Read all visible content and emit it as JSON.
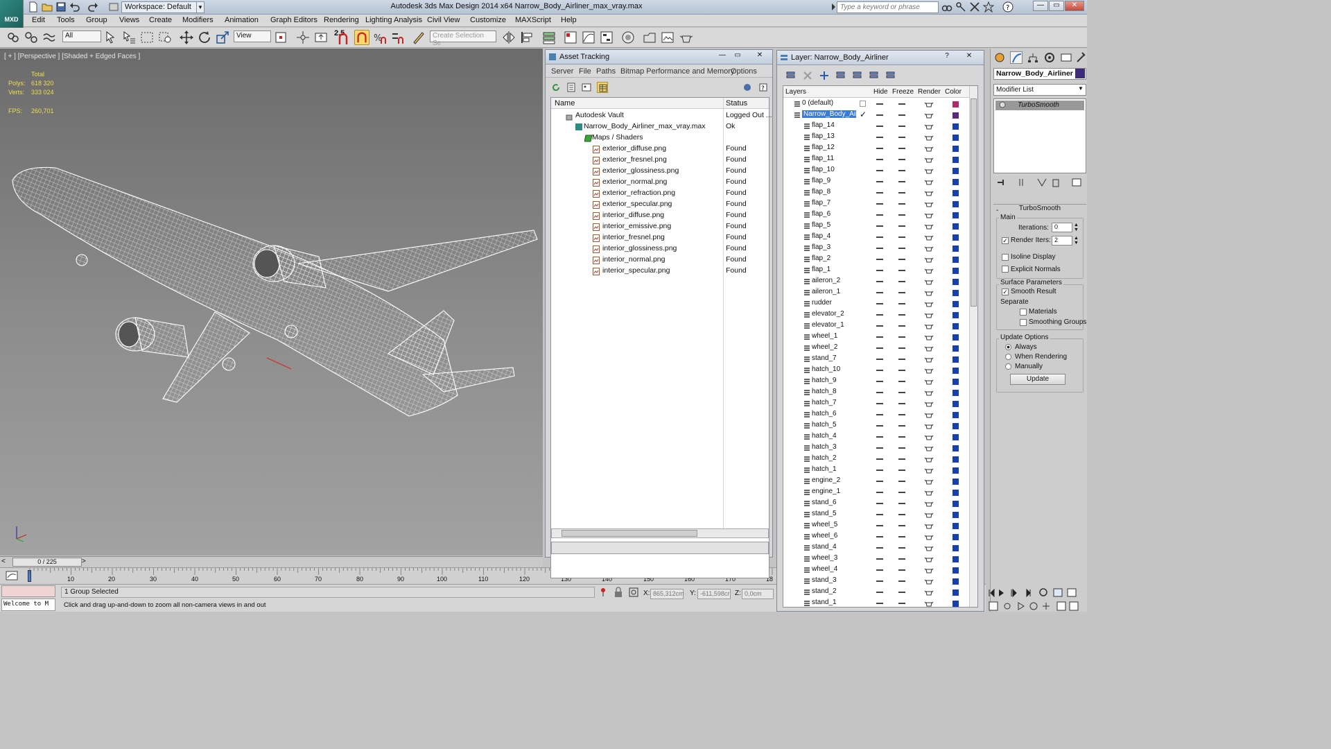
{
  "app": {
    "logo": "MXD",
    "title": "Autodesk 3ds Max Design 2014 x64     Narrow_Body_Airliner_max_vray.max",
    "workspace": "Workspace: Default",
    "search_placeholder": "Type a keyword or phrase"
  },
  "menus": [
    "Edit",
    "Tools",
    "Group",
    "Views",
    "Create",
    "Modifiers",
    "Animation",
    "Graph Editors",
    "Rendering",
    "Lighting Analysis",
    "Civil View",
    "Customize",
    "MAXScript",
    "Help"
  ],
  "toolbar": {
    "filter": "All",
    "ref_coord": "View",
    "snap_value": "2.5",
    "selection_set_placeholder": "Create Selection Se"
  },
  "viewport": {
    "label": "[ + ] [Perspective ] [Shaded + Edged Faces ]",
    "stats": {
      "total_label": "Total",
      "polys_label": "Polys:",
      "polys": "618 320",
      "verts_label": "Verts:",
      "verts": "333 024",
      "fps_label": "FPS:",
      "fps": "260,701"
    }
  },
  "time": {
    "slider": "0 / 225",
    "ticks": [
      "10",
      "20",
      "30",
      "40",
      "50",
      "60",
      "70",
      "80",
      "90",
      "100",
      "110",
      "120",
      "130",
      "140",
      "150",
      "160",
      "170",
      "18"
    ]
  },
  "status": {
    "listener": "Welcome to M",
    "selected": "1 Group Selected",
    "prompt": "Click and drag up-and-down to zoom all non-camera views in and out",
    "x_label": "X:",
    "x": "865,312cm",
    "y_label": "Y:",
    "y": "-611,598cr",
    "z_label": "Z:",
    "z": "0,0cm"
  },
  "asset_tracking": {
    "title": "Asset Tracking",
    "menus": [
      "Server",
      "File",
      "Paths",
      "Bitmap Performance and Memory",
      "Options"
    ],
    "col_name": "Name",
    "col_status": "Status",
    "vault": "Autodesk Vault",
    "vault_status": "Logged Out ...",
    "file": "Narrow_Body_Airliner_max_vray.max",
    "file_status": "Ok",
    "group": "Maps / Shaders",
    "maps": [
      {
        "name": "exterior_diffuse.png",
        "status": "Found"
      },
      {
        "name": "exterior_fresnel.png",
        "status": "Found"
      },
      {
        "name": "exterior_glossiness.png",
        "status": "Found"
      },
      {
        "name": "exterior_normal.png",
        "status": "Found"
      },
      {
        "name": "exterior_refraction.png",
        "status": "Found"
      },
      {
        "name": "exterior_specular.png",
        "status": "Found"
      },
      {
        "name": "interior_diffuse.png",
        "status": "Found"
      },
      {
        "name": "interior_emissive.png",
        "status": "Found"
      },
      {
        "name": "interior_fresnel.png",
        "status": "Found"
      },
      {
        "name": "interior_glossiness.png",
        "status": "Found"
      },
      {
        "name": "interior_normal.png",
        "status": "Found"
      },
      {
        "name": "interior_specular.png",
        "status": "Found"
      }
    ]
  },
  "layer_panel": {
    "title": "Layer: Narrow_Body_Airliner",
    "col_layers": "Layers",
    "col_hide": "Hide",
    "col_freeze": "Freeze",
    "col_render": "Render",
    "col_color": "Color",
    "default_layer": "0 (default)",
    "active_layer": "Narrow_Body_Airlin",
    "items": [
      "flap_14",
      "flap_13",
      "flap_12",
      "flap_11",
      "flap_10",
      "flap_9",
      "flap_8",
      "flap_7",
      "flap_6",
      "flap_5",
      "flap_4",
      "flap_3",
      "flap_2",
      "flap_1",
      "aileron_2",
      "aileron_1",
      "rudder",
      "elevator_2",
      "elevator_1",
      "wheel_1",
      "wheel_2",
      "stand_7",
      "hatch_10",
      "hatch_9",
      "hatch_8",
      "hatch_7",
      "hatch_6",
      "hatch_5",
      "hatch_4",
      "hatch_3",
      "hatch_2",
      "hatch_1",
      "engine_2",
      "engine_1",
      "stand_6",
      "stand_5",
      "wheel_5",
      "wheel_6",
      "stand_4",
      "wheel_3",
      "wheel_4",
      "stand_3",
      "stand_2",
      "stand_1"
    ]
  },
  "command_panel": {
    "object_name": "Narrow_Body_Airliner",
    "modifier_list": "Modifier List",
    "modifier": "TurboSmooth",
    "rollout": "TurboSmooth",
    "main": "Main",
    "iterations_label": "Iterations:",
    "iterations": "0",
    "render_iters_label": "Render Iters:",
    "render_iters": "2",
    "isoline": "Isoline Display",
    "explicit_normals": "Explicit Normals",
    "surface_params": "Surface Parameters",
    "smooth_result": "Smooth Result",
    "separate": "Separate",
    "materials": "Materials",
    "smoothing_groups": "Smoothing Groups",
    "update_options": "Update Options",
    "always": "Always",
    "when_rendering": "When Rendering",
    "manually": "Manually",
    "update_button": "Update"
  },
  "colors": {
    "accent": "#f7d86a",
    "layer_default": "#b0286e",
    "layer_active": "#5a2a7a",
    "layer_item": "#1a3fa8",
    "viewport_bg": "#7a7a7a",
    "stats": "#f0de4a"
  }
}
